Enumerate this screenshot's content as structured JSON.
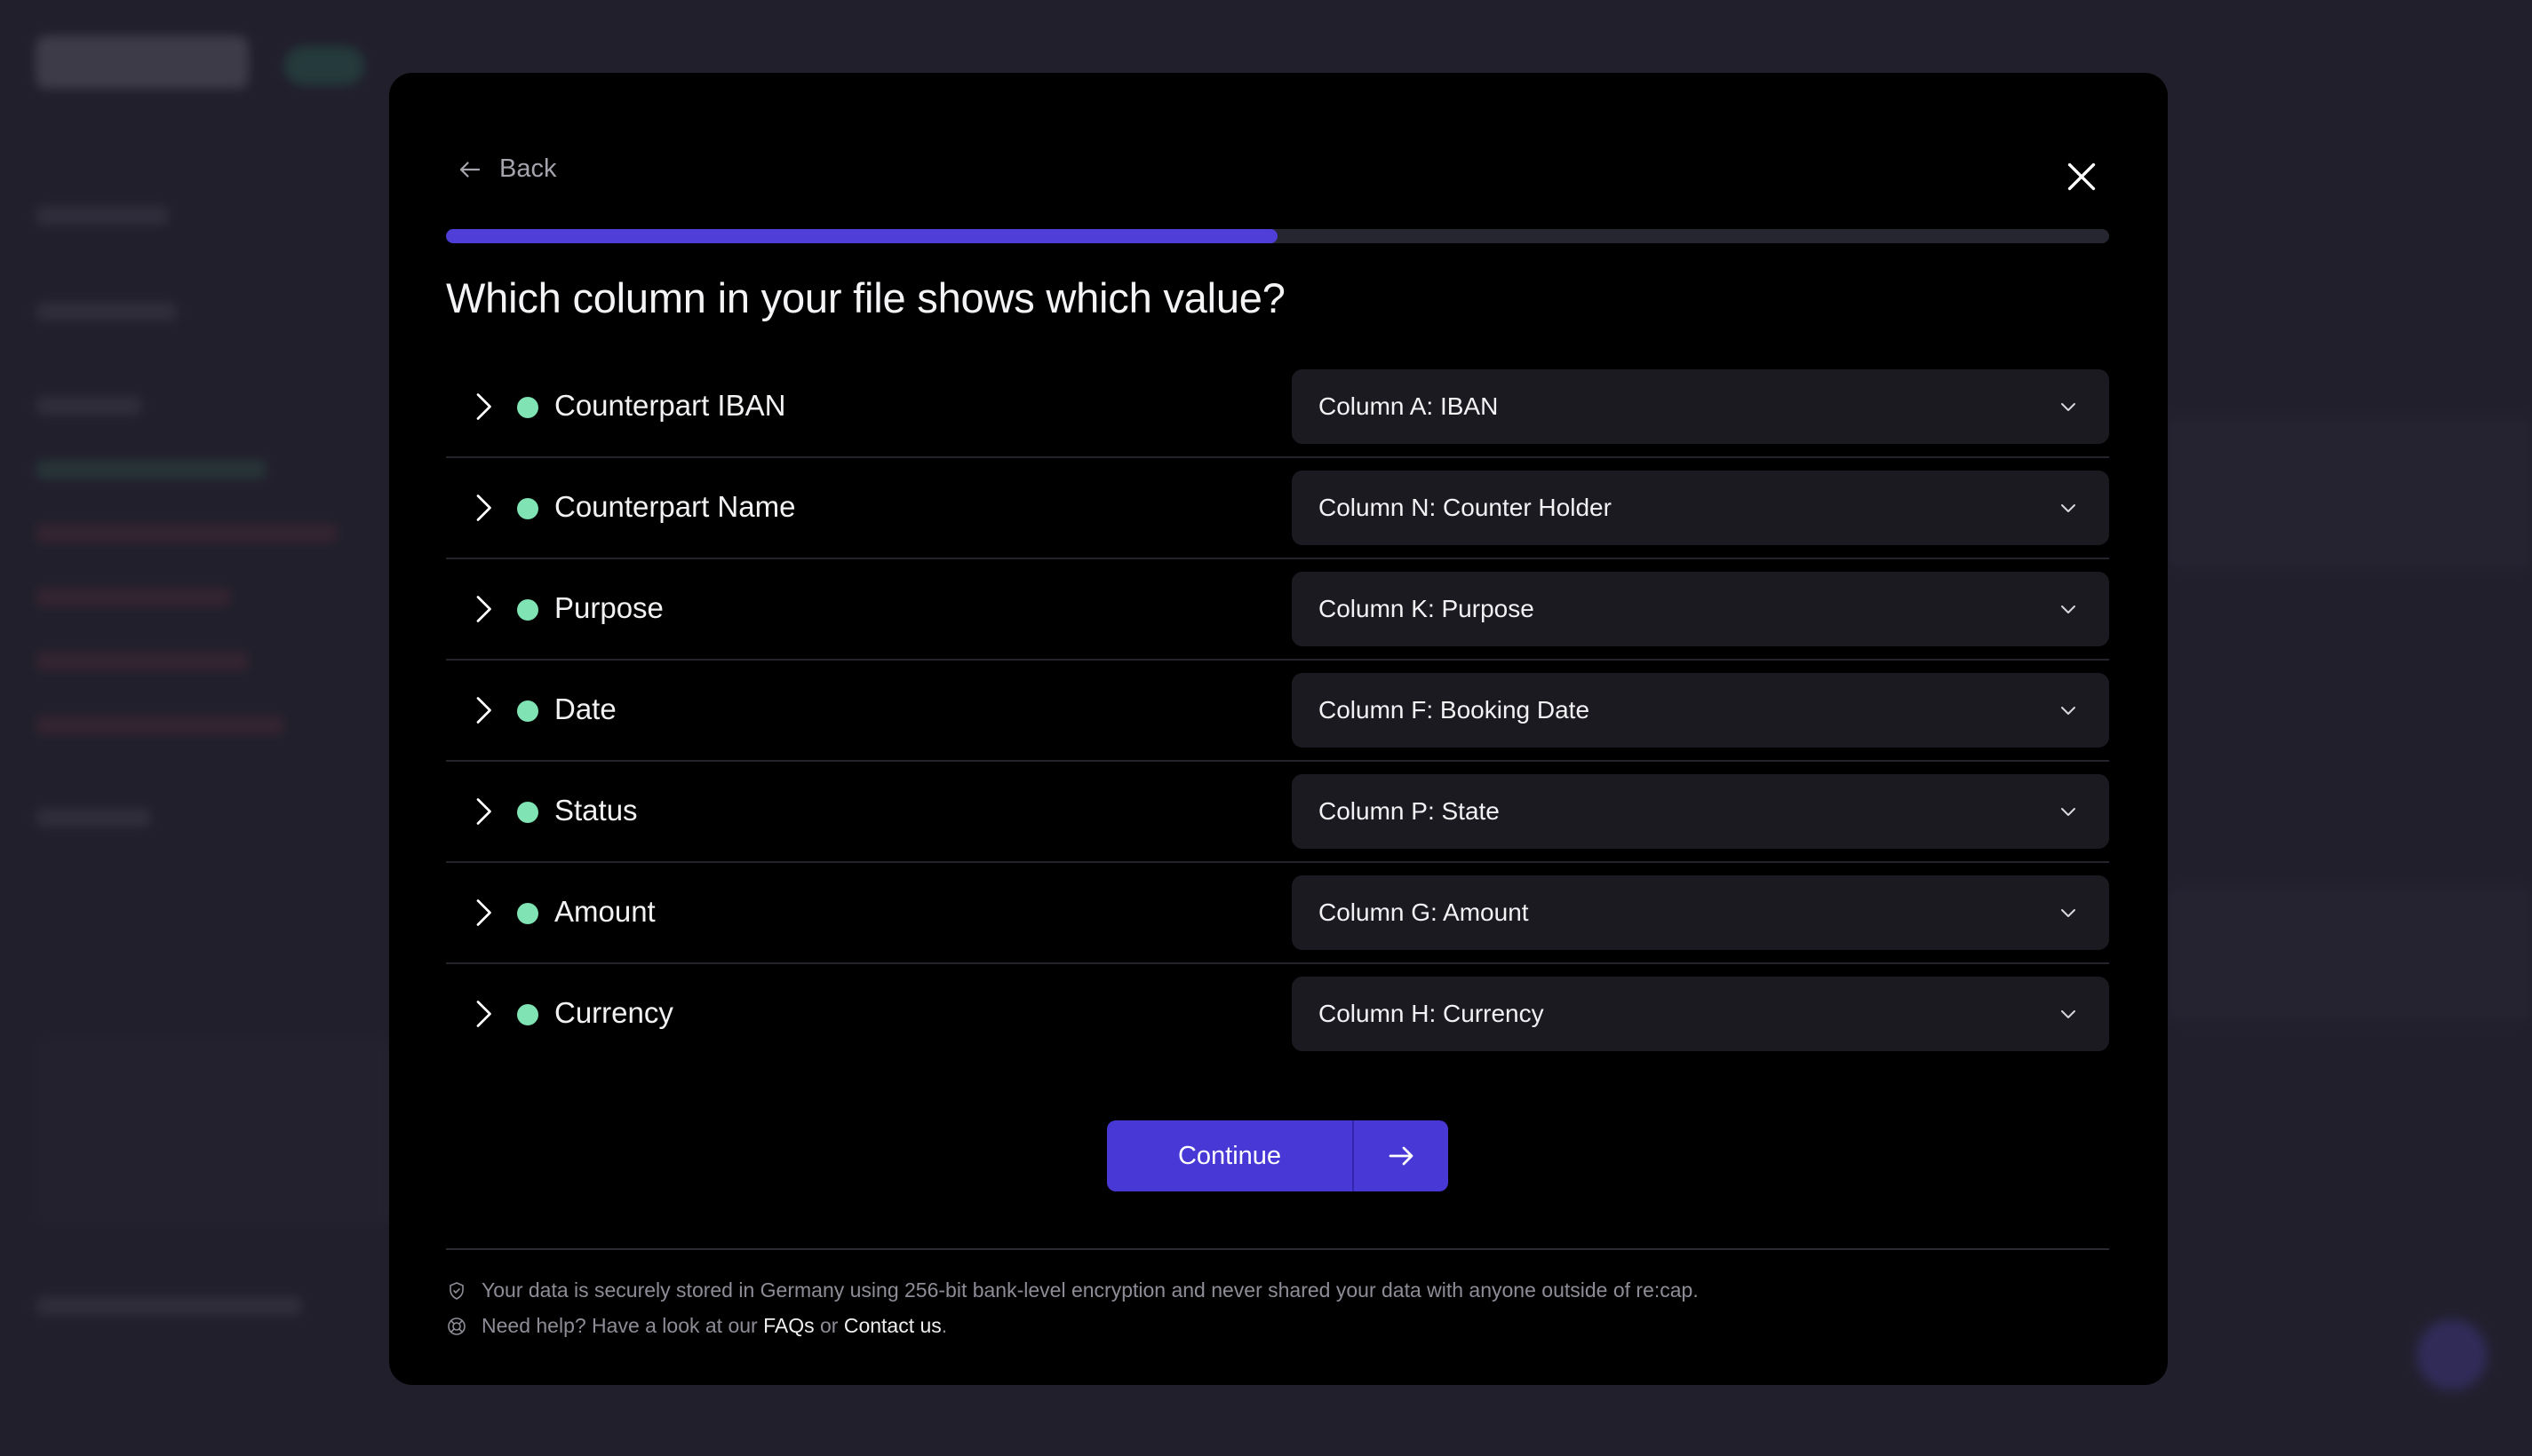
{
  "colors": {
    "accent": "#4838d6",
    "progress_fill": "#4f3fd8",
    "status_dot": "#7fe3b4",
    "modal_bg": "#000000",
    "select_bg": "#1a1a20"
  },
  "modal": {
    "back_label": "Back",
    "progress_fraction": 0.5,
    "title": "Which column in your file shows which value?",
    "continue_label": "Continue",
    "mappings": [
      {
        "field": "Counterpart IBAN",
        "column": "Column A: IBAN",
        "status": "mapped"
      },
      {
        "field": "Counterpart Name",
        "column": "Column N: Counter Holder",
        "status": "mapped"
      },
      {
        "field": "Purpose",
        "column": "Column K: Purpose",
        "status": "mapped"
      },
      {
        "field": "Date",
        "column": "Column F: Booking Date",
        "status": "mapped"
      },
      {
        "field": "Status",
        "column": "Column P: State",
        "status": "mapped"
      },
      {
        "field": "Amount",
        "column": "Column G: Amount",
        "status": "mapped"
      },
      {
        "field": "Currency",
        "column": "Column H: Currency",
        "status": "mapped"
      }
    ],
    "footer": {
      "security_text": "Your data is securely stored in Germany using 256-bit bank-level encryption and never shared your data with anyone outside of re:cap.",
      "help_prefix": "Need help? Have a look at our",
      "faq_link": "FAQs",
      "help_or": "or",
      "contact_link": "Contact us",
      "help_suffix": "."
    }
  }
}
